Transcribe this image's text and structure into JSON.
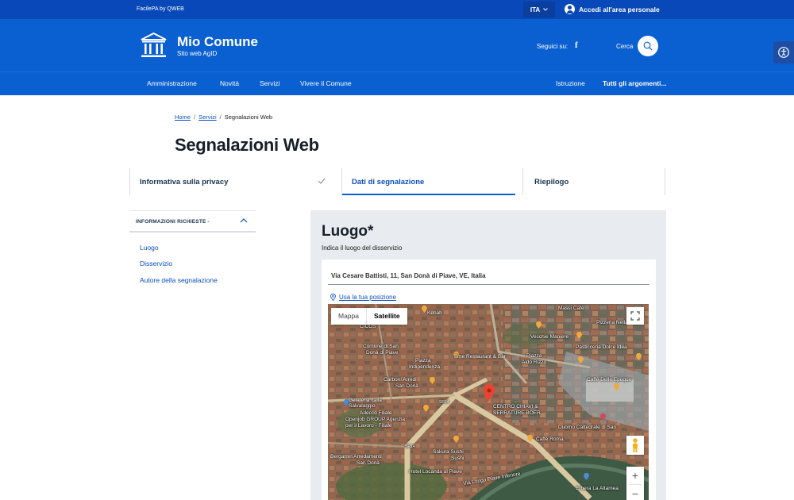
{
  "topbar": {
    "brand": "FacilePA by QWEB",
    "language": "ITA",
    "login": "Accedi all'area personale"
  },
  "header": {
    "site_title": "Mio Comune",
    "site_subtitle": "Sito web AgID",
    "follow_label": "Seguici su:",
    "social_icon": "facebook-icon",
    "search_label": "Cerca"
  },
  "nav": {
    "items": [
      "Amministrazione",
      "Novità",
      "Servizi",
      "Vivere il Comune"
    ],
    "right_items": [
      "Istruzione",
      "Tutti gli argomenti..."
    ]
  },
  "breadcrumb": {
    "home": "Home",
    "services": "Servizi",
    "current": "Segnalazioni Web"
  },
  "page_title": "Segnalazioni Web",
  "steps": [
    {
      "label": "Informativa sulla privacy",
      "state": "completed"
    },
    {
      "label": "Dati di segnalazione",
      "state": "active"
    },
    {
      "label": "Riepilogo",
      "state": "pending"
    }
  ],
  "sidebar": {
    "heading": "INFORMAZIONI RICHIESTE -",
    "items": [
      "Luogo",
      "Disservizio",
      "Autore della segnalazione"
    ]
  },
  "form": {
    "title": "Luogo*",
    "subtitle": "Indica il luogo del disservizio",
    "address": "Via Cesare Battisti, 11, San Donà di Piave, VE, Italia",
    "use_position": "Usa la tua posizione"
  },
  "map": {
    "tabs": [
      "Mappa",
      "Satellite"
    ],
    "active_tab": "Satellite",
    "zoom_in": "+",
    "zoom_out": "−",
    "labels": {
      "l1": "Massi Cafè",
      "l2": "Kebab",
      "l3": "CICOS",
      "l4": "Pizzeria Nella",
      "l5": "Comune di San",
      "l6": "Donà di Piave",
      "l7": "Vecchie Maniere",
      "l8": "Pasticceria Dolce Idea",
      "l9": "Piazza",
      "l10": "Indipendenza",
      "l11": "Time Restaurant & Bar",
      "l12": "Piazza",
      "l13": "Aldo Rizzo",
      "l14": "Caffè Delle Epoque",
      "l15": "Carboni Arredi",
      "l16": "San Donà",
      "l17": "Gelateria Italia",
      "l18": "Salvalaggio",
      "l19": "Adecco Filiale",
      "l20": "Openjob GROUP Agenzia",
      "l21": "per il Lavoro - Filiale",
      "l22": "CENTRO CHIAVI &",
      "l23": "SERRATURE BOER",
      "l24": "Caffè Roma",
      "l25": "Duomo Cattedrale di San",
      "l26": "Sakura Sushi",
      "l27": "Sushi",
      "l28": "Bergamin Arredamenti",
      "l29": "San Donà",
      "l30": "Hotel Locanda al Piave",
      "l31": "Via Lungo Piave Inferiore",
      "l32": "Erbera La Altamea",
      "r1": "SR14",
      "r2": "SR14"
    }
  },
  "colors": {
    "primary": "#0a5fd1",
    "topbar": "#0848b8",
    "link": "#0a4fc2",
    "card_bg": "#e8ebef"
  }
}
